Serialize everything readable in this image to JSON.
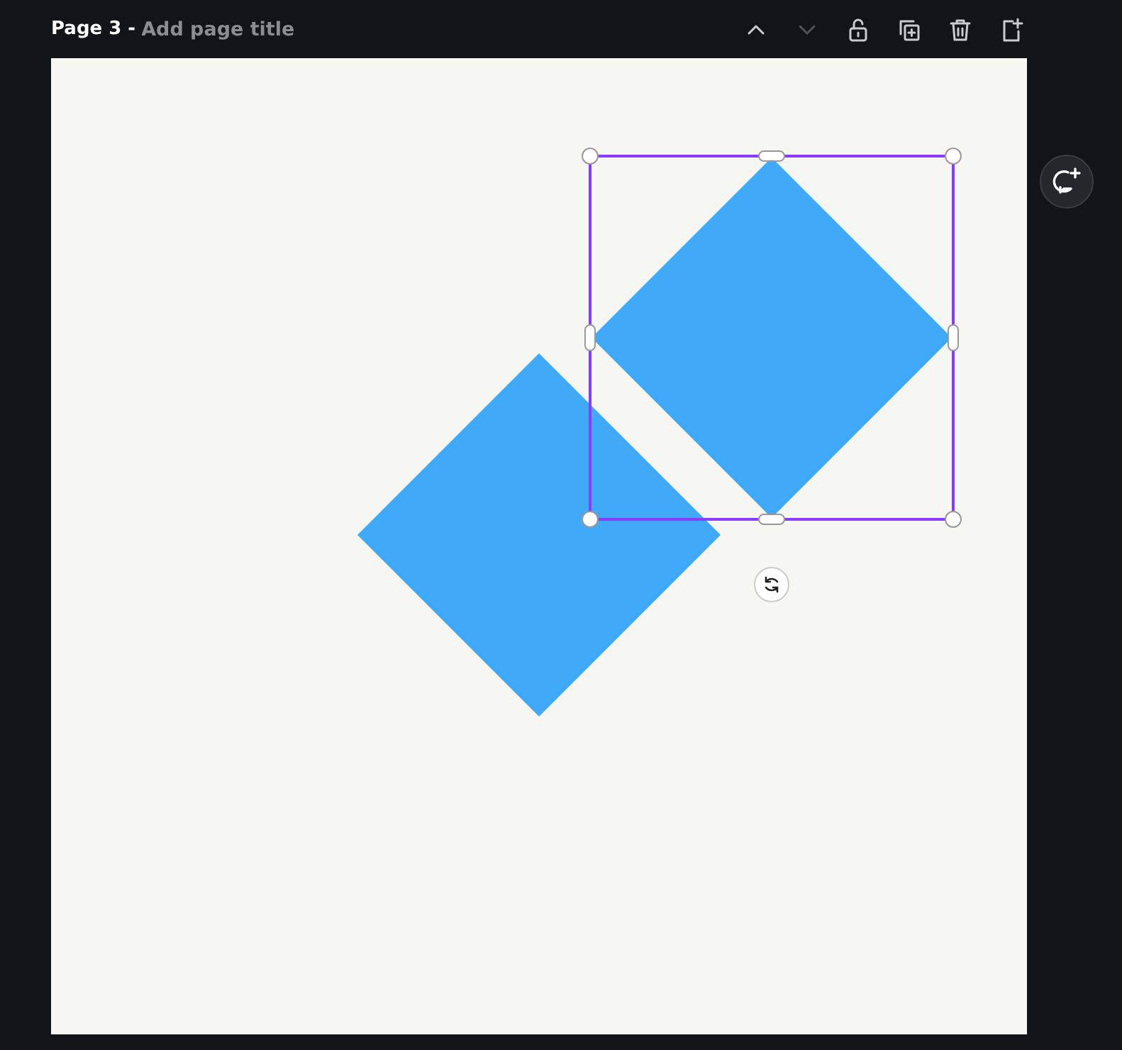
{
  "header": {
    "page_label": "Page 3 -",
    "title": {
      "placeholder": "Add page title"
    }
  },
  "toolbar": [
    {
      "kind": "up",
      "disabled": false
    },
    {
      "kind": "down",
      "disabled": true
    },
    {
      "kind": "lock",
      "disabled": false
    },
    {
      "kind": "duplicate",
      "disabled": false
    },
    {
      "kind": "delete",
      "disabled": false
    },
    {
      "kind": "add",
      "disabled": false
    }
  ],
  "canvas": {
    "shapes": [
      {
        "kind": "diamond",
        "selected": true
      },
      {
        "kind": "diamond",
        "selected": false
      }
    ]
  }
}
